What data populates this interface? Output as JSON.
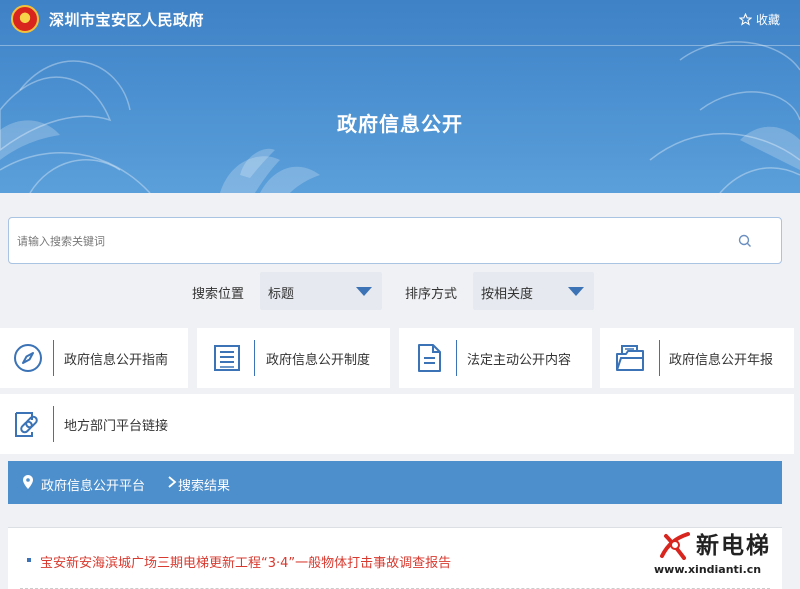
{
  "header": {
    "site_title": "深圳市宝安区人民政府",
    "favorite_label": "收藏",
    "page_title": "政府信息公开"
  },
  "search": {
    "placeholder": "请输入搜索关键词",
    "value": ""
  },
  "filters": {
    "position_label": "搜索位置",
    "position_value": "标题",
    "sort_label": "排序方式",
    "sort_value": "按相关度"
  },
  "tiles": [
    {
      "label": "政府信息公开指南",
      "icon": "compass-icon"
    },
    {
      "label": "政府信息公开制度",
      "icon": "list-document-icon"
    },
    {
      "label": "法定主动公开内容",
      "icon": "document-icon"
    },
    {
      "label": "政府信息公开年报",
      "icon": "folder-icon"
    },
    {
      "label": "地方部门平台链接",
      "icon": "link-icon"
    }
  ],
  "breadcrumb": {
    "root": "政府信息公开平台",
    "current": "搜索结果"
  },
  "results": [
    {
      "title": "宝安新安海滨城广场三期电梯更新工程“3·4”一般物体打击事故调查报告"
    }
  ],
  "watermark": {
    "brand": "新电梯",
    "url": "www.xindianti.cn"
  },
  "colors": {
    "banner": "#4a8fd0",
    "accent": "#3b73b6",
    "link": "#d83a2f",
    "breadcrumb_bar": "#4d8fcc"
  }
}
